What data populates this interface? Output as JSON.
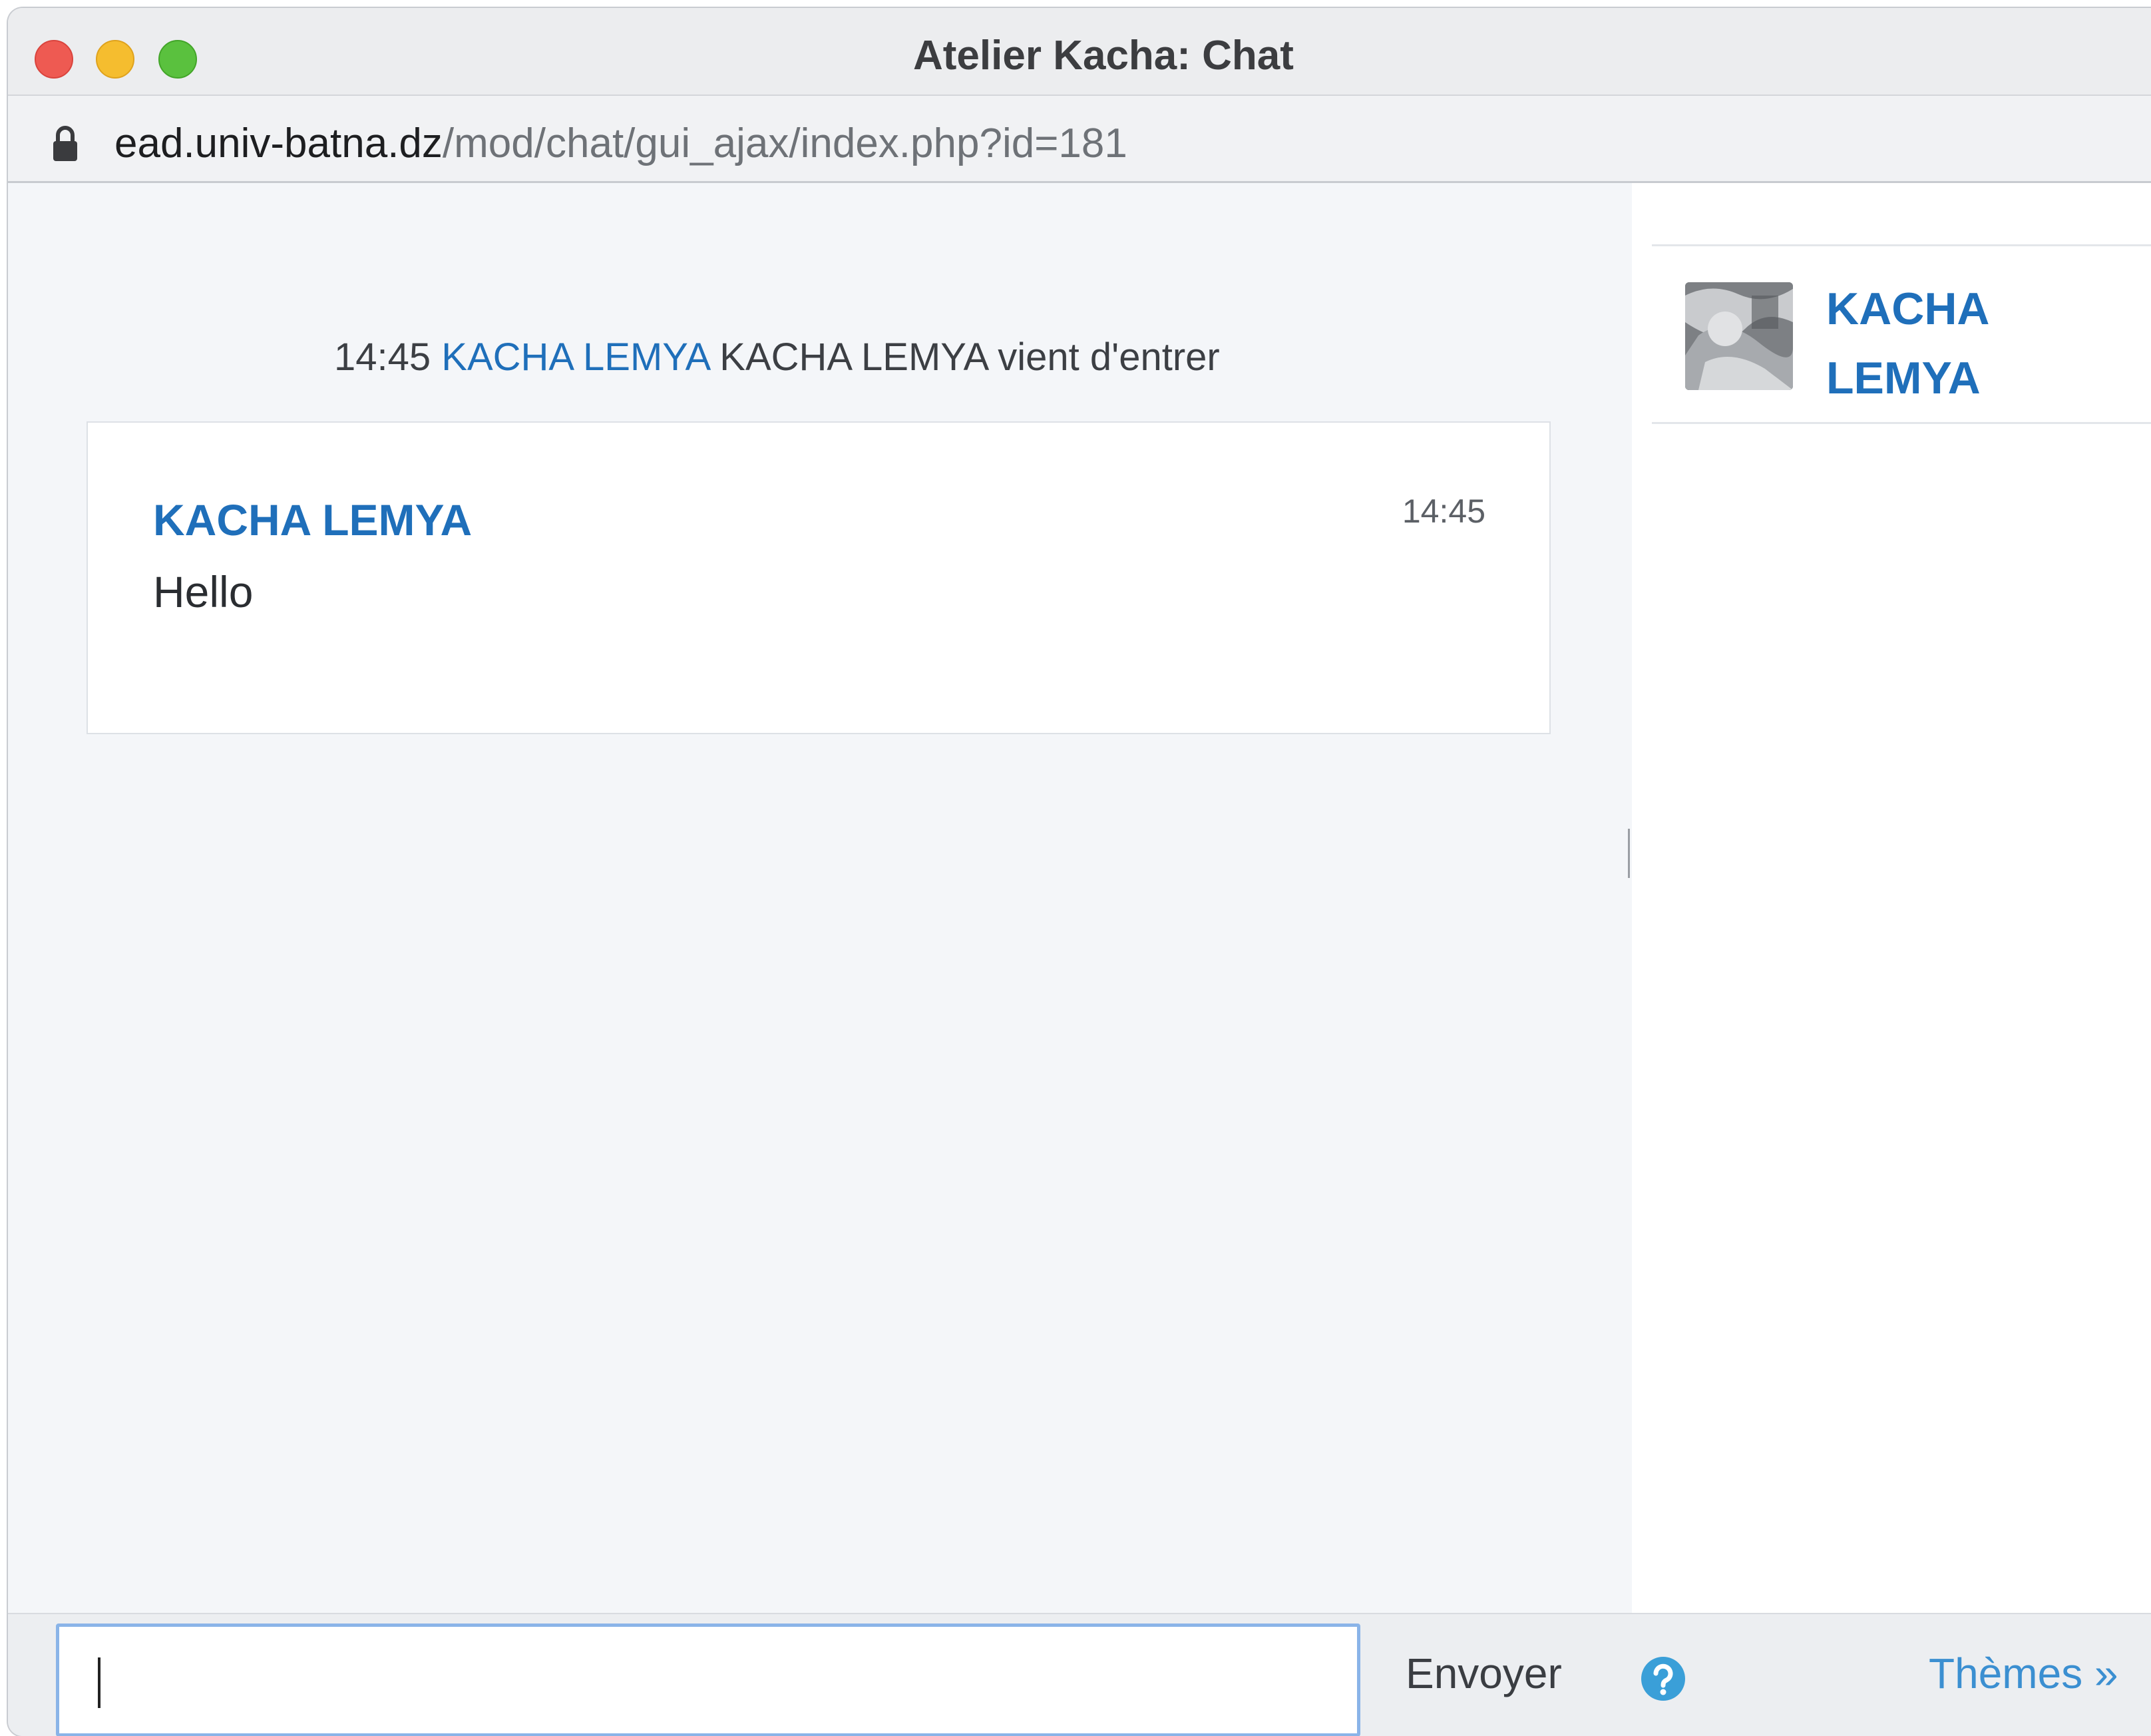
{
  "window": {
    "title": "Atelier Kacha: Chat"
  },
  "address_bar": {
    "host": "ead.univ-batna.dz",
    "path": "/mod/chat/gui_ajax/index.php?id=181"
  },
  "chat": {
    "system_message": {
      "time": "14:45",
      "user_link": "KACHA LEMYA",
      "text": "KACHA LEMYA vient d'entrer"
    },
    "messages": [
      {
        "author": "KACHA LEMYA",
        "time": "14:45",
        "text": "Hello"
      }
    ]
  },
  "users": [
    {
      "first_line": "KACHA",
      "second_line": "LEMYA",
      "avatar_icon": "user-photo-avatar"
    }
  ],
  "composer": {
    "value": "",
    "send_label": "Envoyer",
    "help_icon": "question-circle-icon",
    "themes_label": "Thèmes »"
  },
  "colors": {
    "link_blue": "#1f6fba",
    "themes_blue": "#3b8fd1",
    "close": "#ee5a52",
    "minimize": "#f5bd2f",
    "zoom": "#5ac13e"
  }
}
